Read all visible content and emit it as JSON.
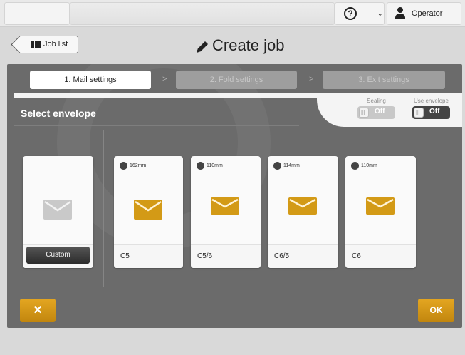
{
  "header": {
    "help_icon": "question-circle-icon",
    "user_label": "Operator"
  },
  "titlebar": {
    "back_label": "Job list",
    "title": "Create job"
  },
  "steps": [
    {
      "label": "1. Mail settings",
      "active": true
    },
    {
      "label": "2. Fold settings",
      "active": false
    },
    {
      "label": "3. Exit settings",
      "active": false
    }
  ],
  "envelope_section": {
    "title": "Select envelope",
    "sealing": {
      "label": "Sealing",
      "state": "Off"
    },
    "use_envelope": {
      "label": "Use envelope",
      "state": "Off"
    },
    "custom_label": "Custom",
    "envelopes": [
      {
        "name": "C5",
        "size": "162mm"
      },
      {
        "name": "C5/6",
        "size": "110mm"
      },
      {
        "name": "C6/5",
        "size": "114mm"
      },
      {
        "name": "C6",
        "size": "110mm"
      }
    ]
  },
  "footer": {
    "cancel_label": "✕",
    "ok_label": "OK"
  },
  "colors": {
    "accent": "#d39a16",
    "panel": "#6b6b6b",
    "envelope_custom": "#c9c9c9"
  }
}
